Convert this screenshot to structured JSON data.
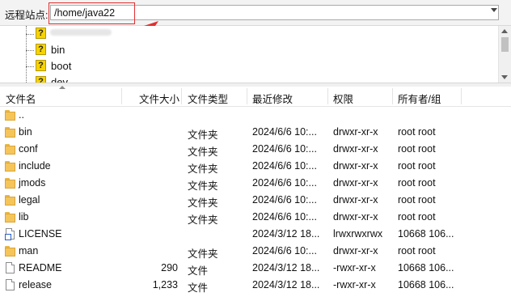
{
  "remote_site": {
    "label": "远程站点:",
    "path": "/home/java22"
  },
  "tree": {
    "items": [
      {
        "label": "",
        "icon": "question-folder-icon"
      },
      {
        "label": "bin",
        "icon": "question-folder-icon"
      },
      {
        "label": "boot",
        "icon": "question-folder-icon"
      },
      {
        "label": "dev",
        "icon": "question-folder-icon"
      }
    ]
  },
  "columns": {
    "name": "文件名",
    "size": "文件大小",
    "type": "文件类型",
    "modified": "最近修改",
    "permissions": "权限",
    "owner": "所有者/组"
  },
  "files": [
    {
      "name": "..",
      "size": "",
      "type": "",
      "modified": "",
      "permissions": "",
      "owner": "",
      "icon": "folder-icon"
    },
    {
      "name": "bin",
      "size": "",
      "type": "文件夹",
      "modified": "2024/6/6 10:...",
      "permissions": "drwxr-xr-x",
      "owner": "root root",
      "icon": "folder-icon"
    },
    {
      "name": "conf",
      "size": "",
      "type": "文件夹",
      "modified": "2024/6/6 10:...",
      "permissions": "drwxr-xr-x",
      "owner": "root root",
      "icon": "folder-icon"
    },
    {
      "name": "include",
      "size": "",
      "type": "文件夹",
      "modified": "2024/6/6 10:...",
      "permissions": "drwxr-xr-x",
      "owner": "root root",
      "icon": "folder-icon"
    },
    {
      "name": "jmods",
      "size": "",
      "type": "文件夹",
      "modified": "2024/6/6 10:...",
      "permissions": "drwxr-xr-x",
      "owner": "root root",
      "icon": "folder-icon"
    },
    {
      "name": "legal",
      "size": "",
      "type": "文件夹",
      "modified": "2024/6/6 10:...",
      "permissions": "drwxr-xr-x",
      "owner": "root root",
      "icon": "folder-icon"
    },
    {
      "name": "lib",
      "size": "",
      "type": "文件夹",
      "modified": "2024/6/6 10:...",
      "permissions": "drwxr-xr-x",
      "owner": "root root",
      "icon": "folder-icon"
    },
    {
      "name": "LICENSE",
      "size": "",
      "type": "",
      "modified": "2024/3/12 18...",
      "permissions": "lrwxrwxrwx",
      "owner": "10668 106...",
      "icon": "symlink-file-icon"
    },
    {
      "name": "man",
      "size": "",
      "type": "文件夹",
      "modified": "2024/6/6 10:...",
      "permissions": "drwxr-xr-x",
      "owner": "root root",
      "icon": "folder-icon"
    },
    {
      "name": "README",
      "size": "290",
      "type": "文件",
      "modified": "2024/3/12 18...",
      "permissions": "-rwxr-xr-x",
      "owner": "10668 106...",
      "icon": "file-icon"
    },
    {
      "name": "release",
      "size": "1,233",
      "type": "文件",
      "modified": "2024/3/12 18...",
      "permissions": "-rwxr-xr-x",
      "owner": "10668 106...",
      "icon": "file-icon"
    }
  ],
  "colors": {
    "annotation": "#e03030",
    "folder": "#f5c55a",
    "unknown_folder": "#f6d300"
  }
}
